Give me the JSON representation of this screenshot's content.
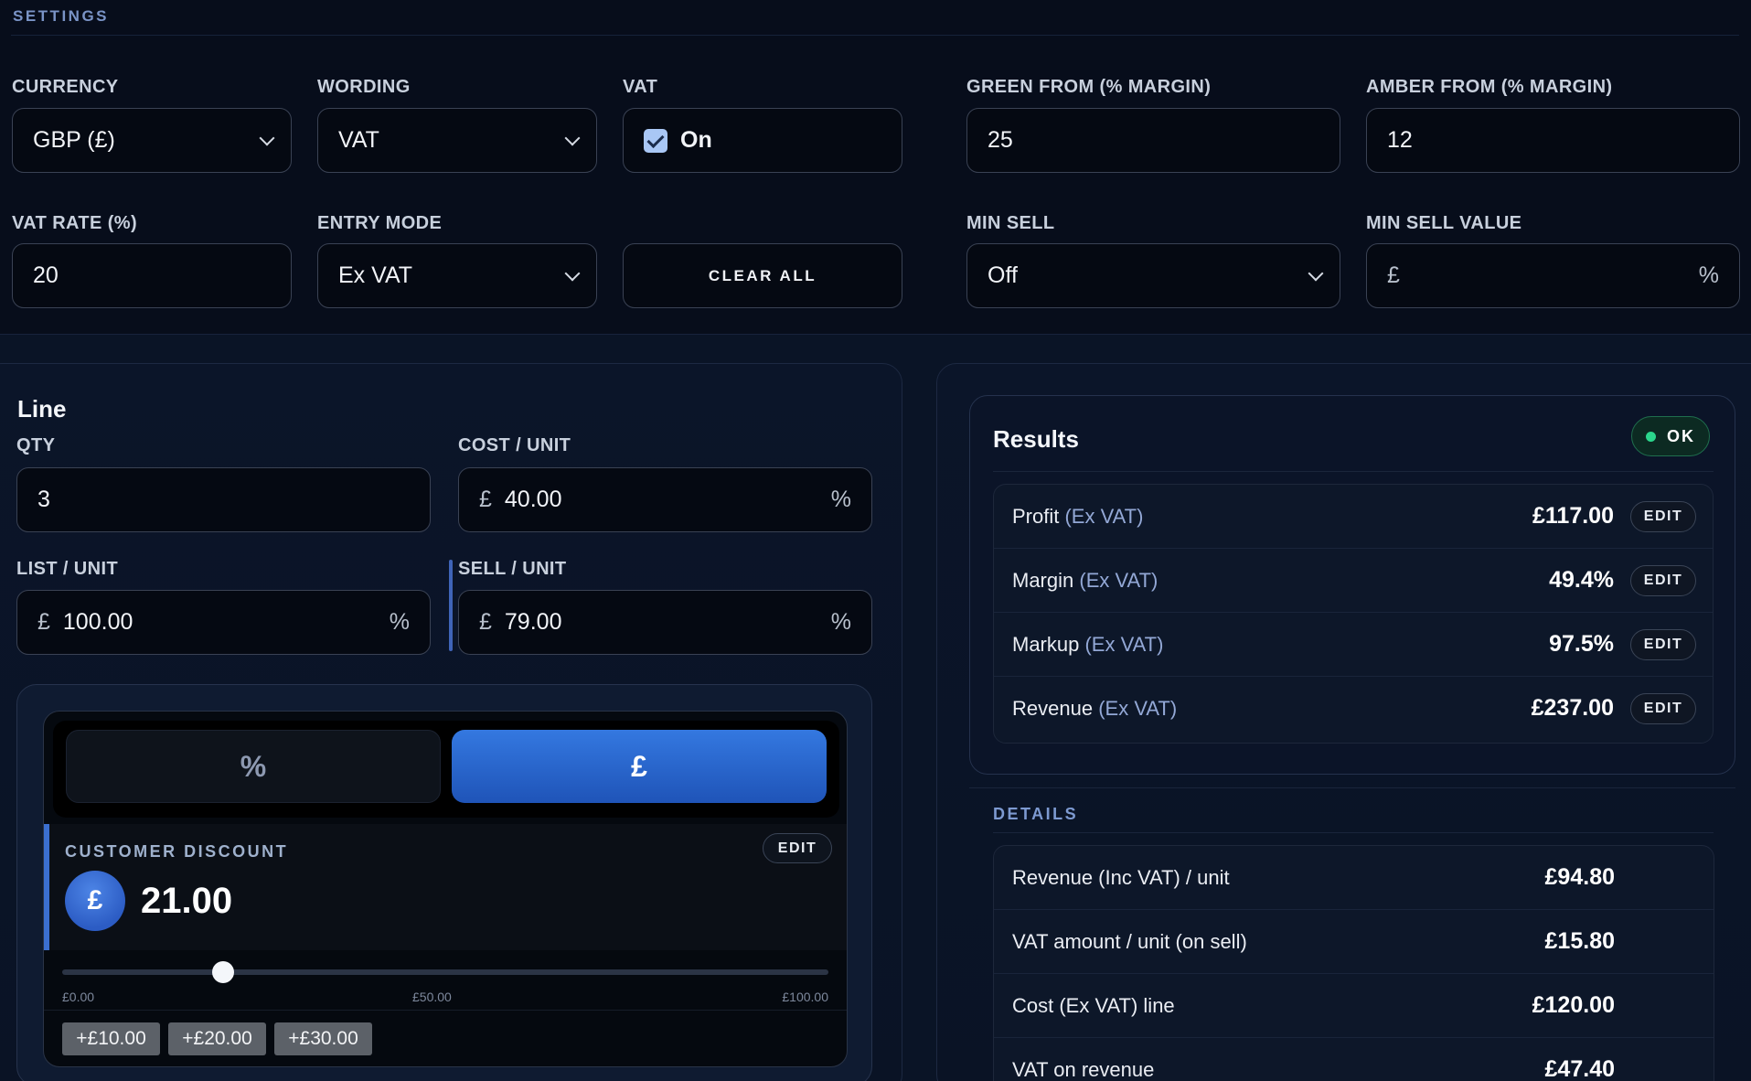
{
  "settings": {
    "title": "SETTINGS",
    "currency": {
      "label": "CURRENCY",
      "value": "GBP (£)"
    },
    "wording": {
      "label": "WORDING",
      "value": "VAT"
    },
    "vat": {
      "label": "VAT",
      "value": "On",
      "checked": true
    },
    "green_from": {
      "label": "GREEN FROM (% MARGIN)",
      "value": "25"
    },
    "amber_from": {
      "label": "AMBER FROM (% MARGIN)",
      "value": "12"
    },
    "vat_rate": {
      "label": "VAT RATE (%)",
      "value": "20"
    },
    "entry_mode": {
      "label": "ENTRY MODE",
      "value": "Ex VAT"
    },
    "clear_all": "CLEAR ALL",
    "min_sell": {
      "label": "MIN SELL",
      "value": "Off"
    },
    "min_sell_value": {
      "label": "MIN SELL VALUE",
      "prefix": "£",
      "suffix": "%",
      "value": ""
    }
  },
  "line": {
    "title": "Line",
    "qty": {
      "label": "QTY",
      "value": "3"
    },
    "cost_unit": {
      "label": "COST / UNIT",
      "prefix": "£",
      "value": "40.00",
      "suffix": "%"
    },
    "list_unit": {
      "label": "LIST / UNIT",
      "prefix": "£",
      "value": "100.00",
      "suffix": "%"
    },
    "sell_unit": {
      "label": "SELL / UNIT",
      "prefix": "£",
      "value": "79.00",
      "suffix": "%"
    },
    "discount": {
      "toggle_percent": "%",
      "toggle_pound": "£",
      "active": "£",
      "label": "CUSTOMER DISCOUNT",
      "edit": "EDIT",
      "coin": "£",
      "value": "21.00",
      "slider": {
        "min": "£0.00",
        "mid": "£50.00",
        "max": "£100.00",
        "fraction": 0.21
      },
      "chips": [
        "+£10.00",
        "+£20.00",
        "+£30.00"
      ]
    }
  },
  "results": {
    "title": "Results",
    "status": "OK",
    "status_color": "#2bd68c",
    "rows": [
      {
        "name": "Profit",
        "sub": "(Ex VAT)",
        "value": "£117.00",
        "edit": "EDIT"
      },
      {
        "name": "Margin",
        "sub": "(Ex VAT)",
        "value": "49.4%",
        "edit": "EDIT"
      },
      {
        "name": "Markup",
        "sub": "(Ex VAT)",
        "value": "97.5%",
        "edit": "EDIT"
      },
      {
        "name": "Revenue",
        "sub": "(Ex VAT)",
        "value": "£237.00",
        "edit": "EDIT"
      }
    ]
  },
  "details": {
    "title": "DETAILS",
    "rows": [
      {
        "name": "Revenue (Inc VAT) / unit",
        "value": "£94.80"
      },
      {
        "name": "VAT amount / unit (on sell)",
        "value": "£15.80"
      },
      {
        "name": "Cost (Ex VAT) line",
        "value": "£120.00"
      },
      {
        "name": "VAT on revenue",
        "value": "£47.40"
      }
    ]
  },
  "colors": {
    "accent": "#2f6ad6",
    "ok": "#2bd68c",
    "background": "#0a1426"
  }
}
